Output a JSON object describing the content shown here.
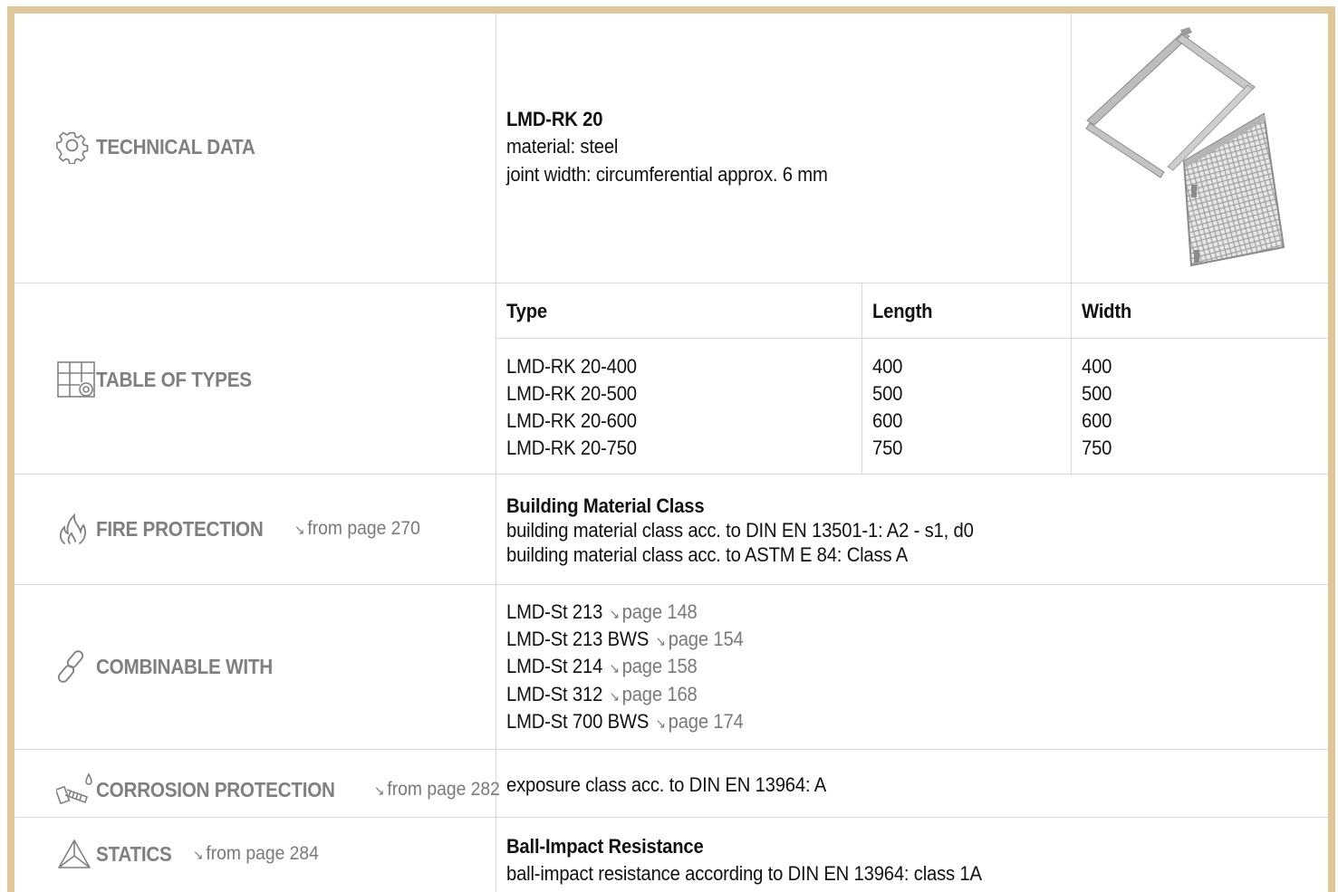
{
  "sections": {
    "technical_data": {
      "label": "TECHNICAL DATA",
      "icon": "gear-icon",
      "product": "LMD-RK 20",
      "lines": [
        "material: steel",
        "joint width: circumferential approx. 6 mm"
      ]
    },
    "table_of_types": {
      "label": "TABLE OF TYPES",
      "icon": "table-gear-icon",
      "headers": [
        "Type",
        "Length",
        "Width"
      ],
      "rows": [
        [
          "LMD-RK 20-400",
          "400",
          "400"
        ],
        [
          "LMD-RK 20-500",
          "500",
          "500"
        ],
        [
          "LMD-RK 20-600",
          "600",
          "600"
        ],
        [
          "LMD-RK 20-750",
          "750",
          "750"
        ]
      ]
    },
    "fire_protection": {
      "label": "FIRE PROTECTION",
      "icon": "flame-icon",
      "ref": "from page 270",
      "heading": "Building Material Class",
      "lines": [
        "building material class acc. to DIN EN 13501-1: A2 - s1, d0",
        "building material class acc. to ASTM E 84: Class A"
      ]
    },
    "combinable_with": {
      "label": "COMBINABLE WITH",
      "icon": "chain-link-icon",
      "items": [
        {
          "name": "LMD-St 213",
          "page": "page 148"
        },
        {
          "name": "LMD-St 213 BWS",
          "page": "page 154"
        },
        {
          "name": "LMD-St 214",
          "page": "page 158"
        },
        {
          "name": "LMD-St 312",
          "page": "page 168"
        },
        {
          "name": "LMD-St 700 BWS",
          "page": "page 174"
        }
      ]
    },
    "corrosion_protection": {
      "label": "CORROSION PROTECTION",
      "icon": "screw-drop-icon",
      "ref": "from page 282",
      "text": "exposure class acc. to DIN EN 13964: A"
    },
    "statics": {
      "label": "STATICS",
      "icon": "triangle-frame-icon",
      "ref": "from page 284",
      "heading": "Ball-Impact Resistance",
      "text": "ball-impact resistance according to DIN EN 13964: class 1A"
    }
  },
  "arrow_glyph": "↘",
  "product_image": "access-panel-photo",
  "colors": {
    "frame": "#e0c798",
    "label_gray": "#808080",
    "rule": "#d8d8d8"
  }
}
